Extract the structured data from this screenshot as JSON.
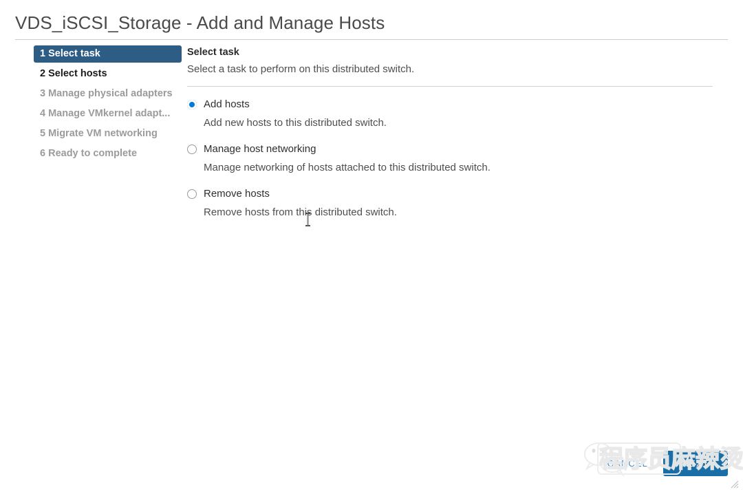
{
  "window": {
    "title": "VDS_iSCSI_Storage - Add and Manage Hosts"
  },
  "nav": {
    "steps": [
      {
        "label": "1 Select task",
        "state": "current"
      },
      {
        "label": "2 Select hosts",
        "state": "visited"
      },
      {
        "label": "3 Manage physical adapters",
        "state": "disabled"
      },
      {
        "label": "4 Manage VMkernel adapt...",
        "state": "disabled"
      },
      {
        "label": "5 Migrate VM networking",
        "state": "disabled"
      },
      {
        "label": "6 Ready to complete",
        "state": "disabled"
      }
    ]
  },
  "main": {
    "heading": "Select task",
    "subheading": "Select a task to perform on this distributed switch.",
    "options": [
      {
        "label": "Add hosts",
        "description": "Add new hosts to this distributed switch.",
        "selected": true
      },
      {
        "label": "Manage host networking",
        "description": "Manage networking of hosts attached to this distributed switch.",
        "selected": false
      },
      {
        "label": "Remove hosts",
        "description": "Remove hosts from this distributed switch.",
        "selected": false
      }
    ]
  },
  "footer": {
    "cancel_label": "CANCEL",
    "primary_label": "NEXT"
  },
  "overlay": {
    "watermark_text": "程序员麻辣烫",
    "wechat_icon": "wechat-logo-icon",
    "resize_icon": "resize-grip-icon",
    "cursor_icon": "text-ibeam-cursor"
  },
  "colors": {
    "nav_current_bg": "#2d5c85",
    "nav_disabled_text": "#9b9b9b",
    "radio_selected": "#0079d8",
    "primary_button_bg": "#1a6ea8",
    "cancel_text": "#3f8ccb",
    "rule": "#d3d3d3"
  }
}
